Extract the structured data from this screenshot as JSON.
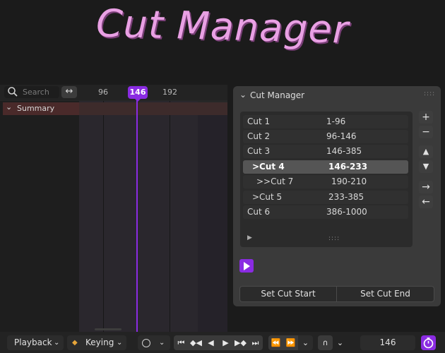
{
  "banner": {
    "title": "Cut Manager"
  },
  "timeline": {
    "search_placeholder": "Search",
    "ticks": [
      "96",
      "192"
    ],
    "current_frame": "146",
    "summary_label": "Summary"
  },
  "panel": {
    "title": "Cut Manager",
    "grip": "::::",
    "cuts": [
      {
        "name": "Cut 1",
        "range": "1-96"
      },
      {
        "name": "Cut 2",
        "range": "96-146"
      },
      {
        "name": "Cut 3",
        "range": "146-385"
      },
      {
        "name": ">Cut 4",
        "range": "146-233",
        "active": true
      },
      {
        "name": ">>Cut 7",
        "range": "190-210"
      },
      {
        "name": ">Cut 5",
        "range": "233-385"
      },
      {
        "name": "Cut 6",
        "range": "386-1000"
      }
    ],
    "side_buttons": [
      "+",
      "−",
      "▲",
      "▼",
      "→",
      "←"
    ],
    "set_start_label": "Set Cut Start",
    "set_end_label": "Set Cut End"
  },
  "bottom_bar": {
    "playback_label": "Playback",
    "keying_label": "Keying",
    "frame_value": "146"
  },
  "colors": {
    "accent": "#8a2be2",
    "title": "#e9a0e4"
  }
}
